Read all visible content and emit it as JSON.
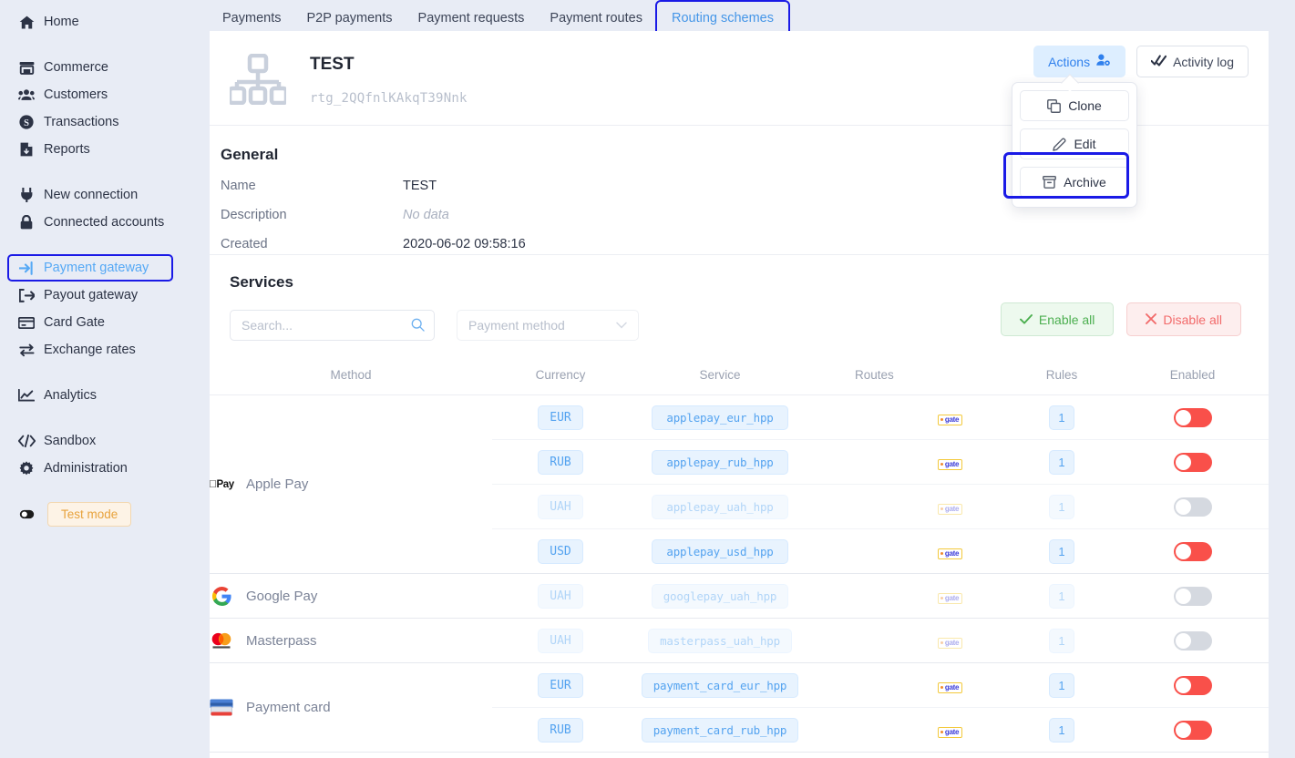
{
  "sidebar": {
    "groups": [
      {
        "items": [
          {
            "icon": "home-icon",
            "label": "Home"
          }
        ]
      },
      {
        "items": [
          {
            "icon": "store-icon",
            "label": "Commerce"
          },
          {
            "icon": "users-icon",
            "label": "Customers"
          },
          {
            "icon": "dollar-circle-icon",
            "label": "Transactions"
          },
          {
            "icon": "report-icon",
            "label": "Reports"
          }
        ]
      },
      {
        "items": [
          {
            "icon": "plug-icon",
            "label": "New connection"
          },
          {
            "icon": "lock-icon",
            "label": "Connected accounts"
          }
        ]
      },
      {
        "items": [
          {
            "icon": "sign-in-icon",
            "label": "Payment gateway",
            "active": true
          },
          {
            "icon": "sign-out-icon",
            "label": "Payout gateway"
          },
          {
            "icon": "card-icon",
            "label": "Card Gate"
          },
          {
            "icon": "exchange-icon",
            "label": "Exchange rates"
          }
        ]
      },
      {
        "items": [
          {
            "icon": "chart-line-icon",
            "label": "Analytics"
          }
        ]
      },
      {
        "items": [
          {
            "icon": "code-icon",
            "label": "Sandbox"
          },
          {
            "icon": "gear-icon",
            "label": "Administration"
          }
        ]
      }
    ],
    "test_mode": {
      "icon": "toggle-icon",
      "label": "Test mode"
    }
  },
  "tabs": [
    {
      "label": "Payments",
      "active": false
    },
    {
      "label": "P2P payments",
      "active": false
    },
    {
      "label": "Payment requests",
      "active": false
    },
    {
      "label": "Payment routes",
      "active": false
    },
    {
      "label": "Routing schemes",
      "active": true
    }
  ],
  "scheme": {
    "icon": "sitemap-icon",
    "title": "TEST",
    "id": "rtg_2QQfnlKAkqT39Nnk",
    "actions_button": {
      "label": "Actions",
      "icon": "user-cog-icon"
    },
    "activity_button": {
      "label": "Activity log",
      "icon": "double-check-icon"
    },
    "dropdown": [
      {
        "label": "Clone",
        "icon": "copy-icon",
        "highlighted": false
      },
      {
        "label": "Edit",
        "icon": "pencil-icon",
        "highlighted": false
      },
      {
        "label": "Archive",
        "icon": "archive-icon",
        "highlighted": true
      }
    ]
  },
  "general": {
    "heading": "General",
    "rows": [
      {
        "key": "Name",
        "value": "TEST",
        "muted": false
      },
      {
        "key": "Description",
        "value": "No data",
        "muted": true
      },
      {
        "key": "Created",
        "value": "2020-06-02 09:58:16",
        "muted": false
      }
    ]
  },
  "services": {
    "heading": "Services",
    "search": {
      "placeholder": "Search...",
      "value": "",
      "icon": "search-icon"
    },
    "method_filter": {
      "placeholder": "Payment method",
      "value": "",
      "icon": "chevron-down-icon"
    },
    "enable_all": {
      "label": "Enable all",
      "icon": "check-icon"
    },
    "disable_all": {
      "label": "Disable all",
      "icon": "cross-icon"
    },
    "columns": [
      "Method",
      "Currency",
      "Service",
      "Routes",
      "Rules",
      "Enabled"
    ],
    "route_badge_label": "gate",
    "groups": [
      {
        "method": "Apple Pay",
        "icon": "applepay-icon",
        "rows": [
          {
            "currency": "EUR",
            "service": "applepay_eur_hpp",
            "route": "gate",
            "rules": "1",
            "enabled": true
          },
          {
            "currency": "RUB",
            "service": "applepay_rub_hpp",
            "route": "gate",
            "rules": "1",
            "enabled": true
          },
          {
            "currency": "UAH",
            "service": "applepay_uah_hpp",
            "route": "gate",
            "rules": "1",
            "enabled": false
          },
          {
            "currency": "USD",
            "service": "applepay_usd_hpp",
            "route": "gate",
            "rules": "1",
            "enabled": true
          }
        ]
      },
      {
        "method": "Google Pay",
        "icon": "googlepay-icon",
        "rows": [
          {
            "currency": "UAH",
            "service": "googlepay_uah_hpp",
            "route": "gate",
            "rules": "1",
            "enabled": false
          }
        ]
      },
      {
        "method": "Masterpass",
        "icon": "masterpass-icon",
        "rows": [
          {
            "currency": "UAH",
            "service": "masterpass_uah_hpp",
            "route": "gate",
            "rules": "1",
            "enabled": false
          }
        ]
      },
      {
        "method": "Payment card",
        "icon": "paymentcard-icon",
        "rows": [
          {
            "currency": "EUR",
            "service": "payment_card_eur_hpp",
            "route": "gate",
            "rules": "1",
            "enabled": true
          },
          {
            "currency": "RUB",
            "service": "payment_card_rub_hpp",
            "route": "gate",
            "rules": "1",
            "enabled": true
          }
        ]
      }
    ]
  },
  "colors": {
    "accent": "#2f80ed",
    "sidebar_bg": "#e8ecf5",
    "highlight_border": "#1a1ae6",
    "toggle_on": "#f9504a",
    "toggle_off": "#d5d9e0",
    "enable_green": "#4caf50",
    "disable_red": "#f26a6a",
    "test_mode_amber": "#e8a33d"
  }
}
